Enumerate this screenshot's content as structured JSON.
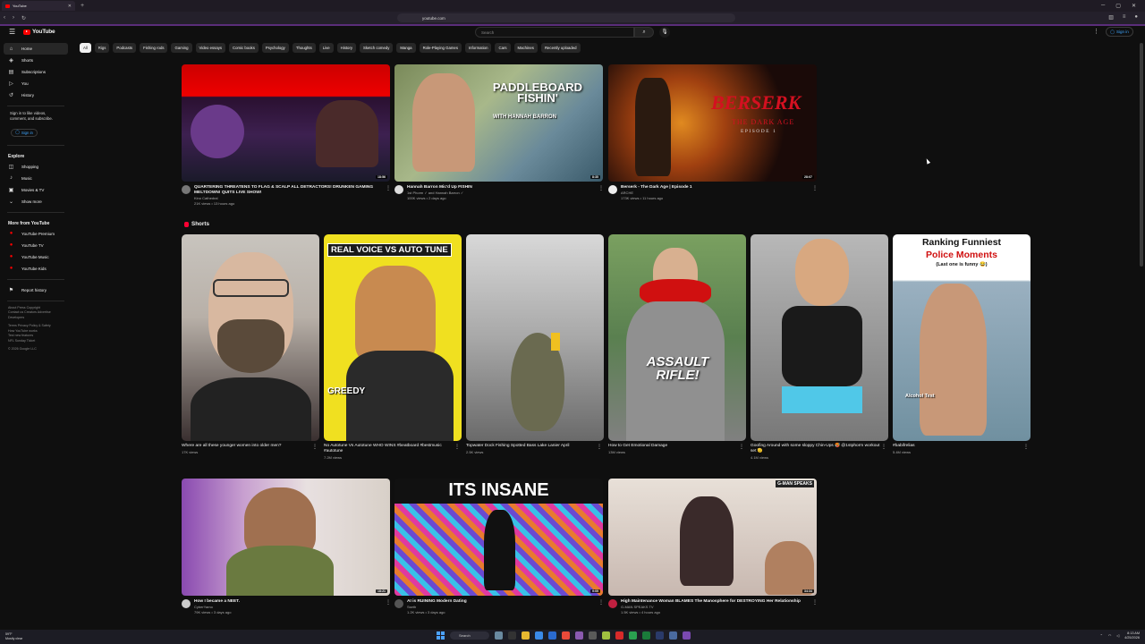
{
  "browser": {
    "tab_title": "YouTube",
    "url": "youtube.com",
    "new_tab": "+"
  },
  "header": {
    "logo": "YouTube",
    "search_placeholder": "Search",
    "sign_in": "Sign in"
  },
  "sidebar": {
    "main": [
      {
        "label": "Home",
        "icon": "home-icon"
      },
      {
        "label": "Shorts",
        "icon": "shorts-icon"
      },
      {
        "label": "Subscriptions",
        "icon": "subscriptions-icon"
      },
      {
        "label": "You",
        "icon": "you-icon"
      },
      {
        "label": "History",
        "icon": "history-icon"
      }
    ],
    "signin_prompt": "Sign in to like videos, comment, and subscribe.",
    "signin_button": "Sign in",
    "explore_title": "Explore",
    "explore": [
      {
        "label": "Shopping",
        "icon": "bag-icon"
      },
      {
        "label": "Music",
        "icon": "music-icon"
      },
      {
        "label": "Movies & TV",
        "icon": "film-icon"
      },
      {
        "label": "Show more",
        "icon": "chevron-down-icon"
      }
    ],
    "more_title": "More from YouTube",
    "more": [
      {
        "label": "YouTube Premium"
      },
      {
        "label": "YouTube TV"
      },
      {
        "label": "YouTube Music"
      },
      {
        "label": "YouTube Kids"
      }
    ],
    "report": "Report history",
    "footer_lines": [
      "About  Press  Copyright",
      "Contact us  Creators  Advertise",
      "Developers",
      "",
      "Terms  Privacy  Policy & Safety",
      "How YouTube works",
      "Test new features",
      "NFL Sunday Ticket",
      "",
      "© 2026 Google LLC"
    ]
  },
  "chips": [
    "All",
    "Rigs",
    "Podcasts",
    "Fishing rods",
    "Gaming",
    "Video essays",
    "Comic books",
    "Psychology",
    "Thoughts",
    "Live",
    "History",
    "Sketch comedy",
    "Manga",
    "Role-Playing Games",
    "Information",
    "Cars",
    "Machines",
    "Recently uploaded"
  ],
  "videos_row1": [
    {
      "title": "QUARTERING THREATENS TO FLAG & SCALP ALL DETRACTORS! DRUNKEN GAMING MELTDOWN! QUITS LIVE SHOW!",
      "channel": "Kino Cathedral",
      "meta": "21K views • 13 hours ago",
      "duration": "18:56",
      "thumb_text": ""
    },
    {
      "title": "Hannah Barron Mic'd Up FISHIN",
      "channel": "1st Phorm ✓ and Hannah Barron ✓",
      "meta": "100K views • 2 days ago",
      "duration": "8:35",
      "thumb_text": "PADDLEBOARD FISHIN'",
      "thumb_sub": "WITH HANNAH BARRON"
    },
    {
      "title": "Berserk - The Dark Age | Episode 1",
      "channel": "ARCHE",
      "meta": "173K views • 11 hours ago",
      "duration": "28:07",
      "thumb_text": "BERSERK",
      "thumb_sub": "THE DARK AGE",
      "thumb_sub2": "EPISODE 1"
    }
  ],
  "shorts": {
    "heading": "Shorts",
    "items": [
      {
        "title": "Where are all these younger women into older men?",
        "views": "17K views",
        "overlay": ""
      },
      {
        "title": "No Autotune Vs Autotune WHO WINS #beatboard #bestmusic #autotune",
        "views": "7.2M views",
        "overlay": "REAL VOICE VS AUTO TUNE",
        "overlay2": "GREEDY"
      },
      {
        "title": "Topwater Dock Fishing Spotted Bass Lake Lanier April",
        "views": "2.5K views",
        "overlay": ""
      },
      {
        "title": "How to Get Emotional Damage",
        "views": "13M views",
        "overlay": "ASSAULT RIFLE!"
      },
      {
        "title": "Goofing Around with some sloppy Chin-Ups 🥵 @1stphorm workout set 🫡",
        "views": "4.1M views",
        "overlay": ""
      },
      {
        "title": "#babifrelias",
        "views": "5.4M views",
        "overlay": "Ranking Funniest",
        "overlay2": "Police Moments",
        "overlay3": "(Last one is funny 😂)",
        "overlay4": "Alcohol Test"
      }
    ]
  },
  "videos_row2": [
    {
      "title": "How I became a NEET.",
      "channel": "CyberYamo",
      "meta": "79K views • 3 days ago",
      "duration": "18:21",
      "thumb_text": ""
    },
    {
      "title": "AI is RUINING Modern Dating",
      "channel": "Sseth",
      "meta": "1.2K views • 3 days ago",
      "duration": "9:09",
      "thumb_text": "ITS INSANE"
    },
    {
      "title": "High Maintenance Woman BLAMES The Manosphere for DESTROYING Her Relationship",
      "channel": "G-MAN SPEAKS TV",
      "meta": "1.5K views • 4 hours ago",
      "duration": "34:34",
      "thumb_text": "G-MAN SPEAKS"
    }
  ],
  "taskbar": {
    "weather_temp": "59°F",
    "weather_desc": "Mostly clear",
    "search": "Search",
    "time": "8:13 AM",
    "date": "4/25/2026"
  },
  "colors": {
    "background": "#0f0f0f",
    "accent_red": "#ff0000",
    "link_blue": "#3ea6ff",
    "chip_bg": "#272727"
  }
}
